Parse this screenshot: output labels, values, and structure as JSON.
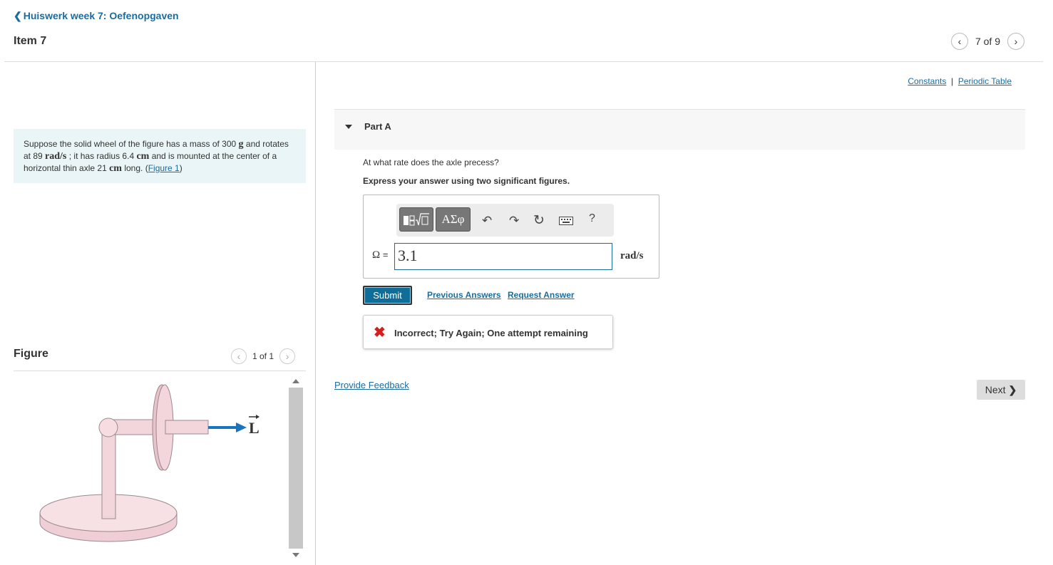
{
  "header": {
    "back_link": "Huiswerk week 7: Oefenopgaven",
    "item_title": "Item 7",
    "pager_text": "7 of 9"
  },
  "problem": {
    "t1": "Suppose the solid wheel of the figure has a mass of 300",
    "u_mass": "g",
    "t2": "and rotates at 89",
    "u_rate": "rad/s",
    "t3": "; it has radius 6.4",
    "u_radius": "cm",
    "t4": "and is mounted at the center of a horizontal thin axle 21",
    "u_len": "cm",
    "t5": "long.",
    "figure_link": "Figure 1"
  },
  "figure": {
    "label": "Figure",
    "pager_text": "1 of 1",
    "vector_label": "L",
    "colors": {
      "wheel": "#f3d6dc",
      "outline": "#9a8a8d",
      "arrow": "#1b75bc"
    }
  },
  "top_links": {
    "constants": "Constants",
    "separator": "|",
    "periodic_table": "Periodic Table"
  },
  "part": {
    "title": "Part A",
    "question": "At what rate does the axle precess?",
    "instructions": "Express your answer using two significant figures."
  },
  "toolbar": {
    "greek_label": "ΑΣφ",
    "help_label": "?"
  },
  "answer": {
    "variable": "Ω",
    "equals": "=",
    "value": "3.1",
    "unit": "rad/s"
  },
  "actions": {
    "submit": "Submit",
    "previous_answers": "Previous Answers",
    "request_answer": "Request Answer"
  },
  "feedback": {
    "message": "Incorrect; Try Again; One attempt remaining"
  },
  "footer": {
    "provide_feedback": "Provide Feedback",
    "next": "Next"
  }
}
